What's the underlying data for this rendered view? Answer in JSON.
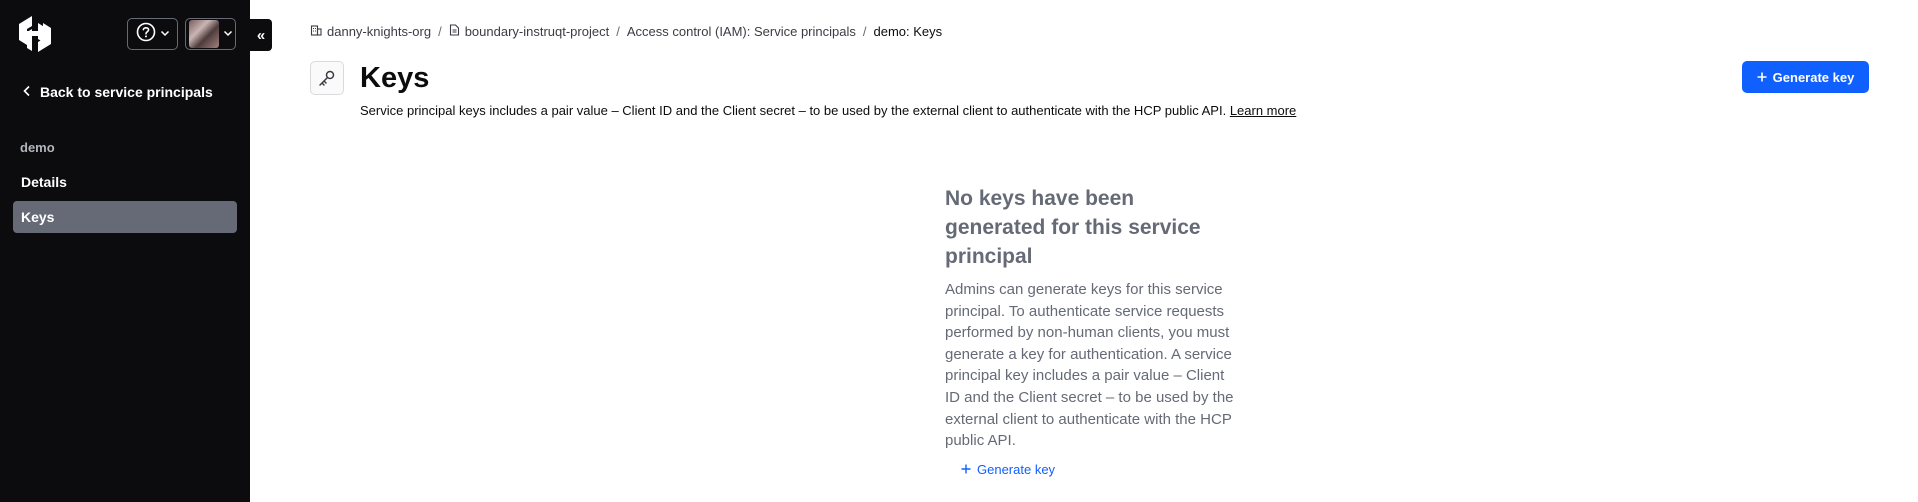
{
  "sidebar": {
    "back_label": "Back to service principals",
    "section_heading": "demo",
    "items": [
      {
        "label": "Details"
      },
      {
        "label": "Keys"
      }
    ]
  },
  "header": {
    "collapse_glyph": "«"
  },
  "breadcrumb": {
    "org": "danny-knights-org",
    "project": "boundary-instruqt-project",
    "section": "Access control (IAM): Service principals",
    "current": "demo: Keys",
    "separator": "/"
  },
  "page": {
    "title": "Keys",
    "description": "Service principal keys includes a pair value – Client ID and the Client secret – to be used by the external client to authenticate with the HCP public API.",
    "learn_more": "Learn more",
    "generate_key_label": "Generate key"
  },
  "empty_state": {
    "title": "No keys have been generated for this service principal",
    "body": "Admins can generate keys for this service principal. To authenticate service requests performed by non-human clients, you must generate a key for authentication. A service principal key includes a pair value – Client ID and the Client secret – to be used by the external client to authenticate with the HCP public API.",
    "action_label": "Generate key"
  },
  "colors": {
    "sidebar_bg": "#0c0c0e",
    "accent": "#1060ff",
    "active_nav": "#656a76"
  }
}
